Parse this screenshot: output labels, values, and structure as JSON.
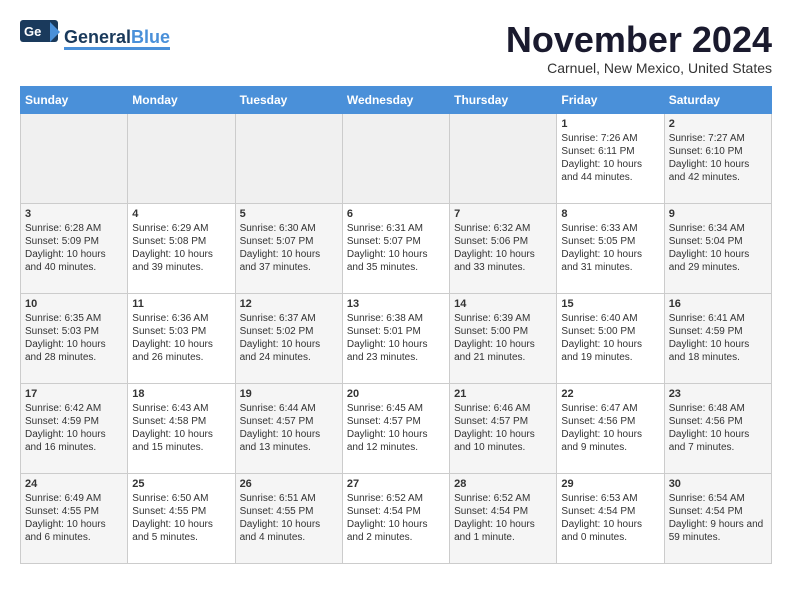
{
  "header": {
    "logo_general": "General",
    "logo_blue": "Blue",
    "month": "November 2024",
    "location": "Carnuel, New Mexico, United States"
  },
  "days_of_week": [
    "Sunday",
    "Monday",
    "Tuesday",
    "Wednesday",
    "Thursday",
    "Friday",
    "Saturday"
  ],
  "weeks": [
    [
      {
        "day": "",
        "content": ""
      },
      {
        "day": "",
        "content": ""
      },
      {
        "day": "",
        "content": ""
      },
      {
        "day": "",
        "content": ""
      },
      {
        "day": "",
        "content": ""
      },
      {
        "day": "1",
        "content": "Sunrise: 7:26 AM\nSunset: 6:11 PM\nDaylight: 10 hours and 44 minutes."
      },
      {
        "day": "2",
        "content": "Sunrise: 7:27 AM\nSunset: 6:10 PM\nDaylight: 10 hours and 42 minutes."
      }
    ],
    [
      {
        "day": "3",
        "content": "Sunrise: 6:28 AM\nSunset: 5:09 PM\nDaylight: 10 hours and 40 minutes."
      },
      {
        "day": "4",
        "content": "Sunrise: 6:29 AM\nSunset: 5:08 PM\nDaylight: 10 hours and 39 minutes."
      },
      {
        "day": "5",
        "content": "Sunrise: 6:30 AM\nSunset: 5:07 PM\nDaylight: 10 hours and 37 minutes."
      },
      {
        "day": "6",
        "content": "Sunrise: 6:31 AM\nSunset: 5:07 PM\nDaylight: 10 hours and 35 minutes."
      },
      {
        "day": "7",
        "content": "Sunrise: 6:32 AM\nSunset: 5:06 PM\nDaylight: 10 hours and 33 minutes."
      },
      {
        "day": "8",
        "content": "Sunrise: 6:33 AM\nSunset: 5:05 PM\nDaylight: 10 hours and 31 minutes."
      },
      {
        "day": "9",
        "content": "Sunrise: 6:34 AM\nSunset: 5:04 PM\nDaylight: 10 hours and 29 minutes."
      }
    ],
    [
      {
        "day": "10",
        "content": "Sunrise: 6:35 AM\nSunset: 5:03 PM\nDaylight: 10 hours and 28 minutes."
      },
      {
        "day": "11",
        "content": "Sunrise: 6:36 AM\nSunset: 5:03 PM\nDaylight: 10 hours and 26 minutes."
      },
      {
        "day": "12",
        "content": "Sunrise: 6:37 AM\nSunset: 5:02 PM\nDaylight: 10 hours and 24 minutes."
      },
      {
        "day": "13",
        "content": "Sunrise: 6:38 AM\nSunset: 5:01 PM\nDaylight: 10 hours and 23 minutes."
      },
      {
        "day": "14",
        "content": "Sunrise: 6:39 AM\nSunset: 5:00 PM\nDaylight: 10 hours and 21 minutes."
      },
      {
        "day": "15",
        "content": "Sunrise: 6:40 AM\nSunset: 5:00 PM\nDaylight: 10 hours and 19 minutes."
      },
      {
        "day": "16",
        "content": "Sunrise: 6:41 AM\nSunset: 4:59 PM\nDaylight: 10 hours and 18 minutes."
      }
    ],
    [
      {
        "day": "17",
        "content": "Sunrise: 6:42 AM\nSunset: 4:59 PM\nDaylight: 10 hours and 16 minutes."
      },
      {
        "day": "18",
        "content": "Sunrise: 6:43 AM\nSunset: 4:58 PM\nDaylight: 10 hours and 15 minutes."
      },
      {
        "day": "19",
        "content": "Sunrise: 6:44 AM\nSunset: 4:57 PM\nDaylight: 10 hours and 13 minutes."
      },
      {
        "day": "20",
        "content": "Sunrise: 6:45 AM\nSunset: 4:57 PM\nDaylight: 10 hours and 12 minutes."
      },
      {
        "day": "21",
        "content": "Sunrise: 6:46 AM\nSunset: 4:57 PM\nDaylight: 10 hours and 10 minutes."
      },
      {
        "day": "22",
        "content": "Sunrise: 6:47 AM\nSunset: 4:56 PM\nDaylight: 10 hours and 9 minutes."
      },
      {
        "day": "23",
        "content": "Sunrise: 6:48 AM\nSunset: 4:56 PM\nDaylight: 10 hours and 7 minutes."
      }
    ],
    [
      {
        "day": "24",
        "content": "Sunrise: 6:49 AM\nSunset: 4:55 PM\nDaylight: 10 hours and 6 minutes."
      },
      {
        "day": "25",
        "content": "Sunrise: 6:50 AM\nSunset: 4:55 PM\nDaylight: 10 hours and 5 minutes."
      },
      {
        "day": "26",
        "content": "Sunrise: 6:51 AM\nSunset: 4:55 PM\nDaylight: 10 hours and 4 minutes."
      },
      {
        "day": "27",
        "content": "Sunrise: 6:52 AM\nSunset: 4:54 PM\nDaylight: 10 hours and 2 minutes."
      },
      {
        "day": "28",
        "content": "Sunrise: 6:52 AM\nSunset: 4:54 PM\nDaylight: 10 hours and 1 minute."
      },
      {
        "day": "29",
        "content": "Sunrise: 6:53 AM\nSunset: 4:54 PM\nDaylight: 10 hours and 0 minutes."
      },
      {
        "day": "30",
        "content": "Sunrise: 6:54 AM\nSunset: 4:54 PM\nDaylight: 9 hours and 59 minutes."
      }
    ]
  ]
}
